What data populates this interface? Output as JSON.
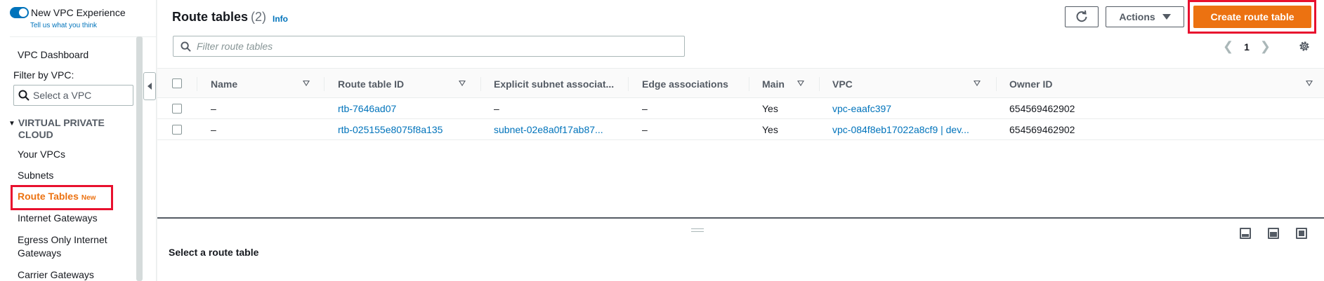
{
  "sidebar": {
    "toggle_label": "New VPC Experience",
    "feedback_link": "Tell us what you think",
    "dashboard": "VPC Dashboard",
    "filter_label": "Filter by VPC:",
    "vpc_select_placeholder": "Select a VPC",
    "section_title": "VIRTUAL PRIVATE CLOUD",
    "items": [
      {
        "label": "Your VPCs"
      },
      {
        "label": "Subnets"
      },
      {
        "label": "Route Tables",
        "badge": "New"
      },
      {
        "label": "Internet Gateways"
      },
      {
        "label": "Egress Only Internet Gateways"
      },
      {
        "label": "Carrier Gateways"
      }
    ]
  },
  "header": {
    "title": "Route tables",
    "count": "(2)",
    "info": "Info",
    "actions_label": "Actions",
    "create_label": "Create route table"
  },
  "filter": {
    "placeholder": "Filter route tables"
  },
  "pagination": {
    "page": "1"
  },
  "table": {
    "columns": [
      "Name",
      "Route table ID",
      "Explicit subnet associat...",
      "Edge associations",
      "Main",
      "VPC",
      "Owner ID"
    ],
    "rows": [
      {
        "name": "–",
        "id": "rtb-7646ad07",
        "subnet": "–",
        "edge": "–",
        "main": "Yes",
        "vpc": "vpc-eaafc397",
        "owner": "654569462902"
      },
      {
        "name": "–",
        "id": "rtb-025155e8075f8a135",
        "subnet": "subnet-02e8a0f17ab87...",
        "edge": "–",
        "main": "Yes",
        "vpc": "vpc-084f8eb17022a8cf9 | dev...",
        "owner": "654569462902"
      }
    ]
  },
  "split_panel": {
    "title": "Select a route table"
  },
  "colors": {
    "accent": "#ec7211",
    "link": "#0073bb",
    "highlight": "#e8102e"
  }
}
